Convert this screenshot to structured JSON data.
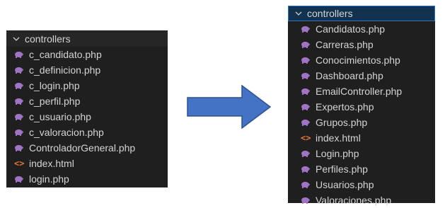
{
  "before": {
    "folder_label": "controllers",
    "files": [
      {
        "name": "c_candidato.php",
        "icon": "php-icon"
      },
      {
        "name": "c_definicion.php",
        "icon": "php-icon"
      },
      {
        "name": "c_login.php",
        "icon": "php-icon"
      },
      {
        "name": "c_perfil.php",
        "icon": "php-icon"
      },
      {
        "name": "c_usuario.php",
        "icon": "php-icon"
      },
      {
        "name": "c_valoracion.php",
        "icon": "php-icon"
      },
      {
        "name": "ControladorGeneral.php",
        "icon": "php-icon"
      },
      {
        "name": "index.html",
        "icon": "html-icon"
      },
      {
        "name": "login.php",
        "icon": "php-icon"
      }
    ]
  },
  "after": {
    "folder_label": "controllers",
    "files": [
      {
        "name": "Candidatos.php",
        "icon": "php-icon"
      },
      {
        "name": "Carreras.php",
        "icon": "php-icon"
      },
      {
        "name": "Conocimientos.php",
        "icon": "php-icon"
      },
      {
        "name": "Dashboard.php",
        "icon": "php-icon"
      },
      {
        "name": "EmailController.php",
        "icon": "php-icon"
      },
      {
        "name": "Expertos.php",
        "icon": "php-icon"
      },
      {
        "name": "Grupos.php",
        "icon": "php-icon"
      },
      {
        "name": "index.html",
        "icon": "html-icon"
      },
      {
        "name": "Login.php",
        "icon": "php-icon"
      },
      {
        "name": "Perfiles.php",
        "icon": "php-icon"
      },
      {
        "name": "Usuarios.php",
        "icon": "php-icon"
      },
      {
        "name": "Valoraciones.php",
        "icon": "php-icon"
      }
    ]
  },
  "colors": {
    "php_icon": "#a074c4",
    "html_icon": "#e37933",
    "arrow_fill": "#4472c4",
    "arrow_stroke": "#2f528f"
  }
}
